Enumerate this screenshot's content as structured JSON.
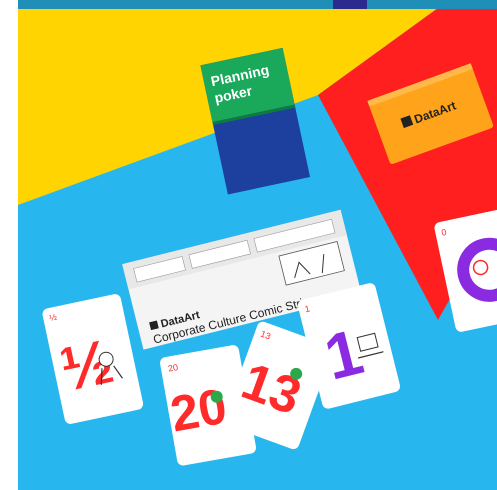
{
  "photo": {
    "alt": "Planning poker cards and a comic strip on colored paper",
    "colors": {
      "top_strip": "#1f8fb8",
      "yellow": "#ffd400",
      "blue": "#28b6ef",
      "red": "#ff1f1f",
      "card_red": "#ff2b2b",
      "card_purple": "#8a2be2",
      "box_green": "#1aa85a",
      "box_navy": "#1d3f9e",
      "orange_box": "#ffa31a"
    }
  },
  "planning_box": {
    "line1": "Planning",
    "line2": "poker"
  },
  "dataart_box": {
    "brand": "DataArt"
  },
  "comic_strip": {
    "brand": "DataArt",
    "title": "Corporate Culture Comic Strip"
  },
  "cards": {
    "half": {
      "value": "½",
      "corner": "½"
    },
    "twenty": {
      "value": "20",
      "corner": "20"
    },
    "thirteen": {
      "value": "13",
      "corner": "13"
    },
    "one": {
      "value": "1",
      "corner": "1"
    },
    "zero": {
      "corner": "0"
    }
  }
}
